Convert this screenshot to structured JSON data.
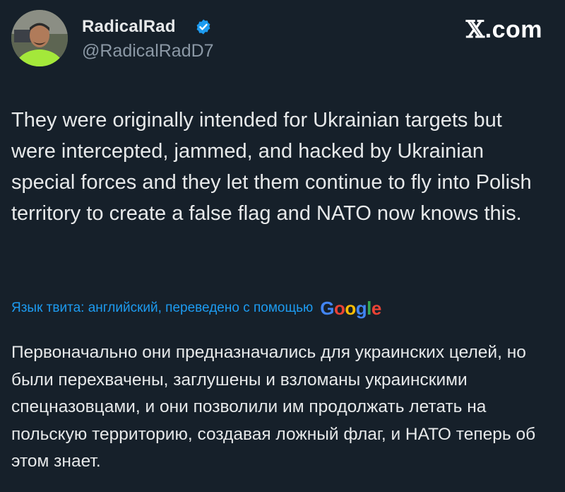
{
  "tweet": {
    "display_name": "RadicalRad",
    "handle": "@RadicalRadD7",
    "verified_icon": "verified-badge-icon",
    "brand": "X.com",
    "brand_suffix": ".com",
    "text": "They were originally intended for Ukrainian targets but were intercepted, jammed, and hacked by Ukrainian special forces and they let them continue to fly into Polish territory to create a false flag and NATO now knows this.",
    "translation_label": "Язык твита: английский, переведено с помощью",
    "translation_provider": "Google",
    "translated_text": "Первоначально они предназначались для украинских целей, но были перехвачены, заглушены и взломаны украинскими спецназовцами, и они позволили им продолжать летать на польскую территорию, создавая ложный флаг, и НАТО теперь об этом знает."
  },
  "colors": {
    "background": "#16202a",
    "text": "#e7e9ea",
    "secondary": "#8b98a5",
    "link": "#1d9bf0",
    "verified": "#1d9bf0"
  }
}
